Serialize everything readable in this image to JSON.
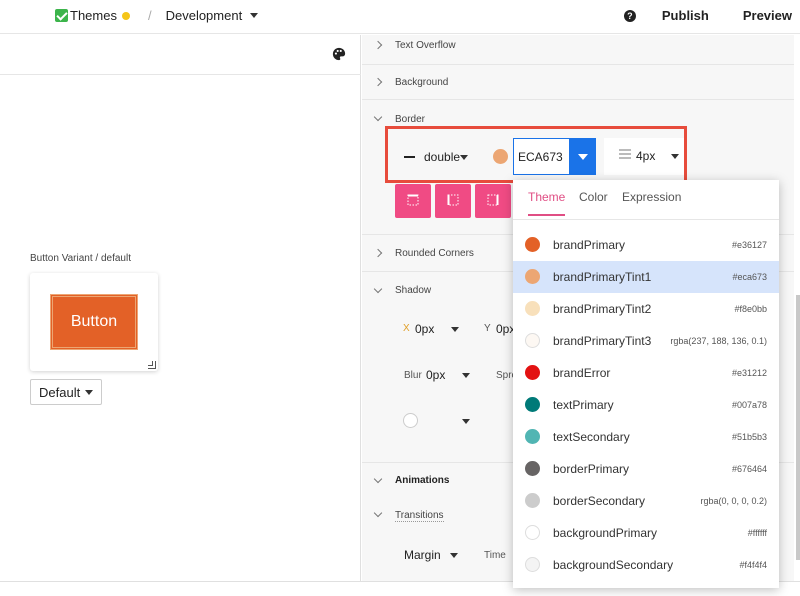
{
  "topbar": {
    "theme_label": "Themes",
    "status_dot_color": "#f5c518",
    "separator": "/",
    "environment": "Development",
    "help_glyph": "?",
    "publish_label": "Publish",
    "preview_label": "Preview"
  },
  "canvas": {
    "variant_label": "Button Variant / default",
    "button_label": "Button",
    "variant_select_value": "Default",
    "icons": [
      "palette-icon"
    ]
  },
  "style_panel": {
    "sections": {
      "text_overflow": "Text Overflow",
      "background": "Background",
      "border": "Border",
      "rounded_corners": "Rounded Corners",
      "shadow": "Shadow",
      "animations": "Animations",
      "transitions": "Transitions"
    },
    "border": {
      "style_value": "double",
      "color_value": "ECA673",
      "swatch_color": "#eca673",
      "width_value": "4px"
    },
    "shadow": {
      "x_label": "X",
      "x_value": "0px",
      "y_label": "Y",
      "y_value": "0px",
      "blur_label": "Blur",
      "blur_value": "0px",
      "spread_label": "Spre"
    },
    "transitions": {
      "property_value": "Margin",
      "time_label": "Time"
    }
  },
  "color_picker": {
    "tabs": [
      "Theme",
      "Color",
      "Expression"
    ],
    "active_tab": "Theme",
    "colors": [
      {
        "name": "brandPrimary",
        "value": "#e36127",
        "swatch": "#e36127"
      },
      {
        "name": "brandPrimaryTint1",
        "value": "#eca673",
        "swatch": "#eca673"
      },
      {
        "name": "brandPrimaryTint2",
        "value": "#f8e0bb",
        "swatch": "#f8e0bb"
      },
      {
        "name": "brandPrimaryTint3",
        "value": "rgba(237, 188, 136, 0.1)",
        "swatch": "#fdf8f3"
      },
      {
        "name": "brandError",
        "value": "#e31212",
        "swatch": "#e31212"
      },
      {
        "name": "textPrimary",
        "value": "#007a78",
        "swatch": "#007a78"
      },
      {
        "name": "textSecondary",
        "value": "#51b5b3",
        "swatch": "#51b5b3"
      },
      {
        "name": "borderPrimary",
        "value": "#676464",
        "swatch": "#676464"
      },
      {
        "name": "borderSecondary",
        "value": "rgba(0, 0, 0, 0.2)",
        "swatch": "#cccccc"
      },
      {
        "name": "backgroundPrimary",
        "value": "#ffffff",
        "swatch": "#ffffff"
      },
      {
        "name": "backgroundSecondary",
        "value": "#f4f4f4",
        "swatch": "#f4f4f4"
      }
    ],
    "selected_index": 1
  }
}
